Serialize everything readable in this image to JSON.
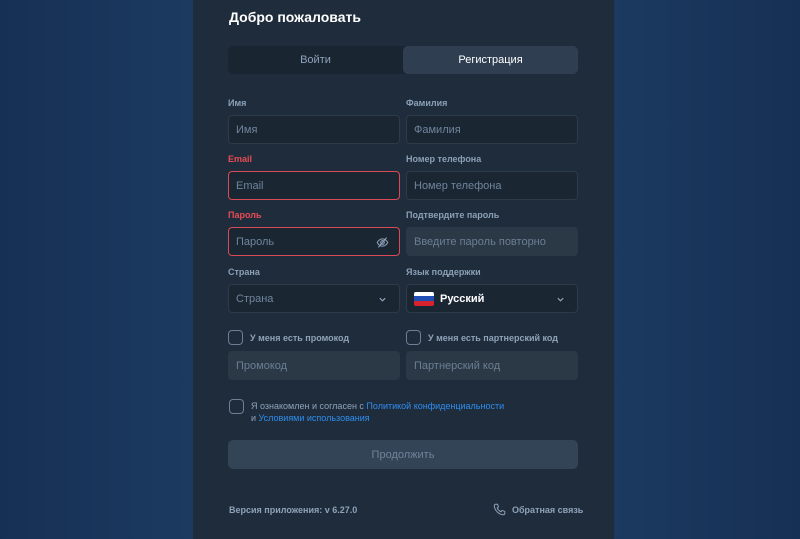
{
  "title": "Добро пожаловать",
  "tabs": [
    {
      "label": "Войти",
      "active": false
    },
    {
      "label": "Регистрация",
      "active": true
    }
  ],
  "form": {
    "first_name": {
      "label": "Имя",
      "placeholder": "Имя"
    },
    "last_name": {
      "label": "Фамилия",
      "placeholder": "Фамилия"
    },
    "email": {
      "label": "Email",
      "placeholder": "Email",
      "error": true
    },
    "phone": {
      "label": "Номер телефона",
      "placeholder": "Номер телефона"
    },
    "password": {
      "label": "Пароль",
      "placeholder": "Пароль",
      "error": true
    },
    "confirm_password": {
      "label": "Подтвердите пароль",
      "placeholder": "Введите пароль повторно"
    },
    "country": {
      "label": "Страна",
      "placeholder": "Страна"
    },
    "support_language": {
      "label": "Язык поддержки",
      "value": "Русский",
      "icon": "russia-flag-icon"
    },
    "promo_checkbox": {
      "label": "У меня есть промокод",
      "checked": false
    },
    "promo_code": {
      "placeholder": "Промокод"
    },
    "partner_checkbox": {
      "label": "У меня есть партнерский код",
      "checked": false
    },
    "partner_code": {
      "placeholder": "Партнерский код"
    },
    "agree": {
      "prefix": "Я ознакомлен и согласен с ",
      "privacy_link": "Политикой конфиденциальности",
      "conj": "и ",
      "terms_link": "Условиями использования",
      "checked": false
    },
    "submit_label": "Продолжить"
  },
  "footer": {
    "version": "Версия приложения: v 6.27.0",
    "feedback": "Обратная связь"
  },
  "colors": {
    "panel": "#1f2c3b",
    "error": "#e84b54",
    "link": "#2f8ef0",
    "label": "#8aa0b7"
  }
}
